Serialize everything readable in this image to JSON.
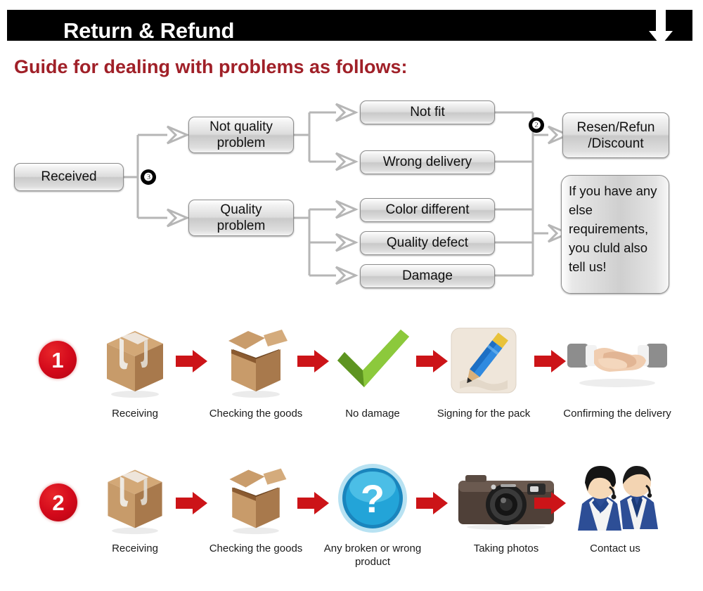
{
  "header": {
    "title": "Return & Refund",
    "down_arrow_icon": "arrow-down-icon",
    "bar_color": "#000000",
    "title_color": "#ffffff"
  },
  "guide": {
    "heading": "Guide for dealing with problems as follows:",
    "heading_color": "#a02028"
  },
  "flowchart": {
    "start": {
      "label": "Received"
    },
    "bubbles": [
      {
        "id": "bubble-3",
        "label": "❸"
      },
      {
        "id": "bubble-2",
        "label": "❷"
      }
    ],
    "branches": [
      {
        "label": "Not quality\nproblem",
        "line1": "Not quality",
        "line2": "problem"
      },
      {
        "label": "Quality\nproblem",
        "line1": "Quality",
        "line2": "problem"
      }
    ],
    "reasons": [
      {
        "label": "Not fit"
      },
      {
        "label": "Wrong delivery"
      },
      {
        "label": "Color different"
      },
      {
        "label": "Quality defect"
      },
      {
        "label": "Damage"
      }
    ],
    "outcomes": [
      {
        "line1": "Resen/Refun",
        "line2": "/Discount"
      },
      {
        "note": "If you have any else requirements, you cluld also tell us!"
      }
    ]
  },
  "process_rows": [
    {
      "badge": "1",
      "badge_color": "#d2081a",
      "steps": [
        {
          "icon": "sealed-box-icon",
          "label": "Receiving"
        },
        {
          "icon": "open-box-icon",
          "label": "Checking the goods"
        },
        {
          "icon": "green-check-icon",
          "label": "No damage"
        },
        {
          "icon": "pencil-signature-icon",
          "label": "Signing for the pack"
        },
        {
          "icon": "handshake-icon",
          "label": "Confirming the delivery"
        }
      ],
      "arrow_icon": "arrow-right-icon",
      "arrow_color": "#cc1418"
    },
    {
      "badge": "2",
      "badge_color": "#d2081a",
      "steps": [
        {
          "icon": "sealed-box-icon",
          "label": "Receiving"
        },
        {
          "icon": "open-box-icon",
          "label": "Checking the goods"
        },
        {
          "icon": "question-mark-icon",
          "label": "Any broken or wrong product"
        },
        {
          "icon": "camera-icon",
          "label": "Taking photos"
        },
        {
          "icon": "support-agents-icon",
          "label": "Contact us"
        }
      ],
      "arrow_icon": "arrow-right-icon",
      "arrow_color": "#cc1418"
    }
  ]
}
